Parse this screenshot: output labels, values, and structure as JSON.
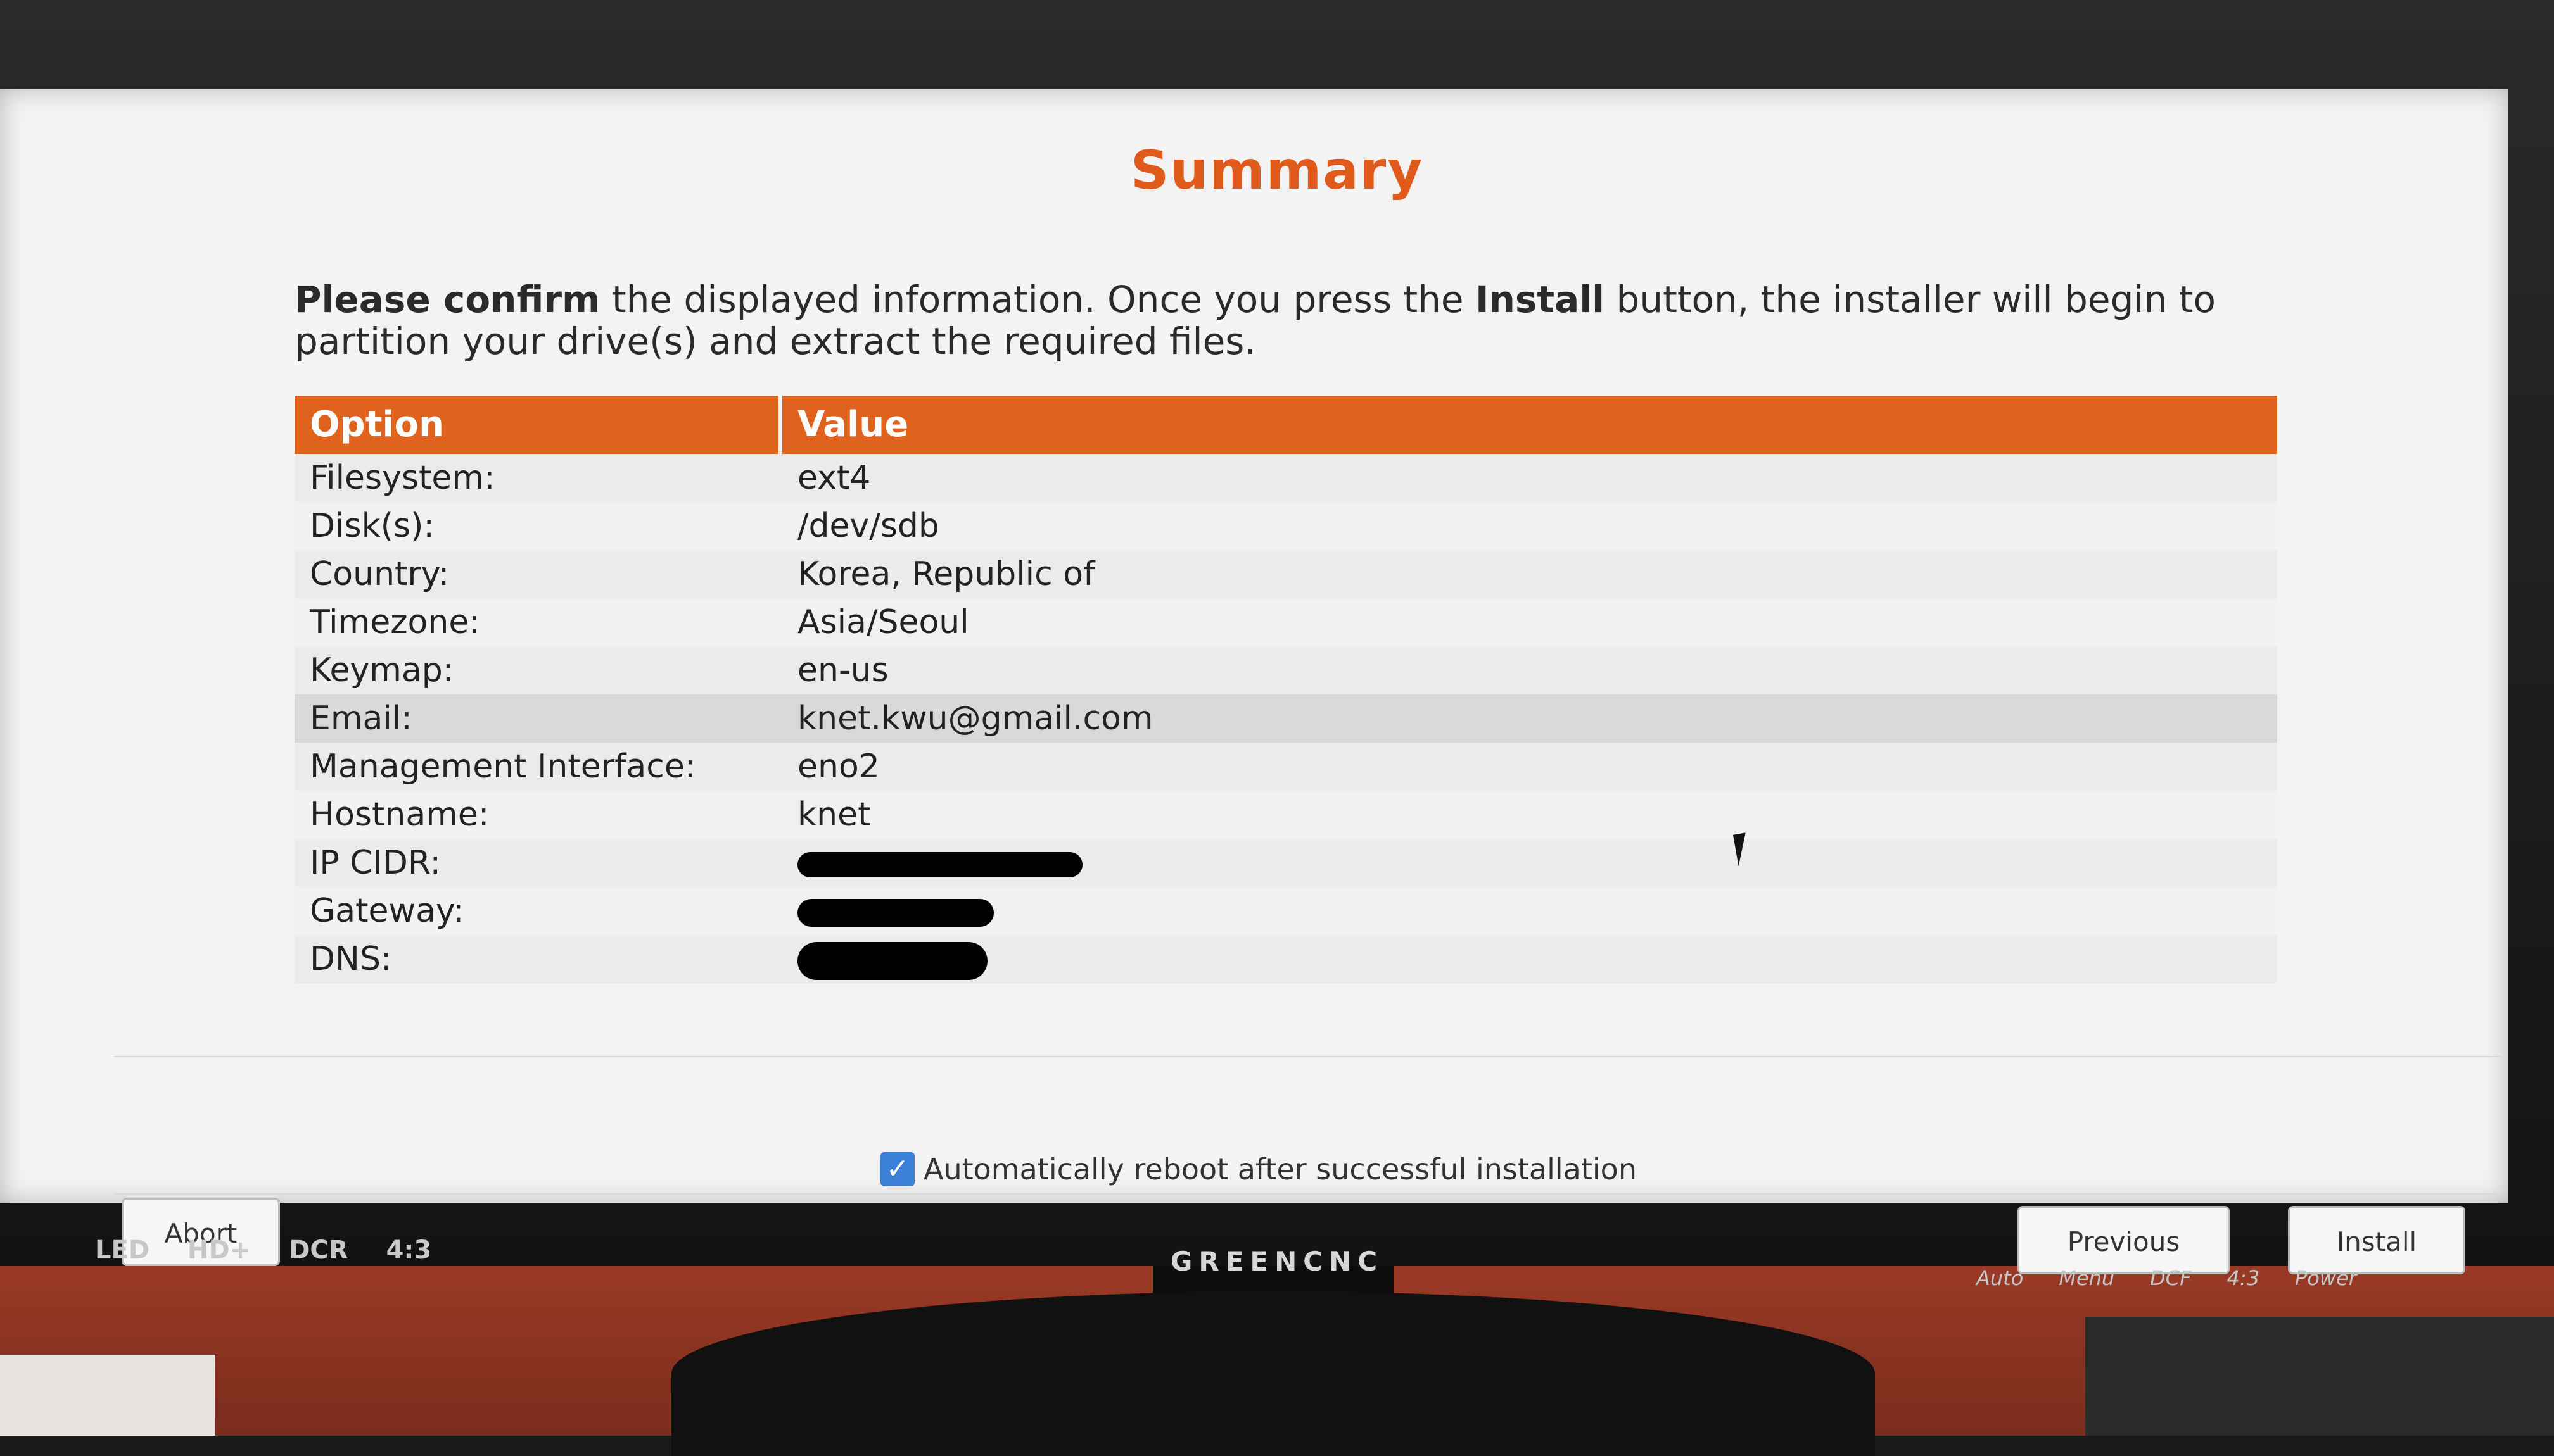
{
  "window": {
    "title": "Summary",
    "intro_bold1": "Please confirm",
    "intro_mid": " the displayed information. Once you press the ",
    "intro_bold2": "Install",
    "intro_end": " button, the installer will begin to partition your drive(s) and extract the required files."
  },
  "table": {
    "headers": [
      "Option",
      "Value"
    ],
    "rows": [
      {
        "option": "Filesystem:",
        "value": "ext4"
      },
      {
        "option": "Disk(s):",
        "value": "/dev/sdb"
      },
      {
        "option": "Country:",
        "value": "Korea, Republic of"
      },
      {
        "option": "Timezone:",
        "value": "Asia/Seoul"
      },
      {
        "option": "Keymap:",
        "value": "en-us"
      },
      {
        "option": "Email:",
        "value": "knet.kwu@gmail.com"
      },
      {
        "option": "Management Interface:",
        "value": "eno2"
      },
      {
        "option": "Hostname:",
        "value": "knet"
      },
      {
        "option": "IP CIDR:",
        "value": ""
      },
      {
        "option": "Gateway:",
        "value": ""
      },
      {
        "option": "DNS:",
        "value": ""
      }
    ]
  },
  "reboot": {
    "label": "Automatically reboot after successful installation",
    "checked": true
  },
  "buttons": {
    "abort": "Abort",
    "previous": "Previous",
    "install": "Install"
  },
  "monitor": {
    "brand": "GREENCNC",
    "badges": [
      "LED",
      "HD+",
      "DCR",
      "4:3"
    ],
    "controls": [
      "Auto",
      "Menu",
      "DCF",
      "4:3",
      "Power"
    ]
  },
  "colors": {
    "accent": "#e0621f",
    "checkbox": "#3b7fd6"
  }
}
